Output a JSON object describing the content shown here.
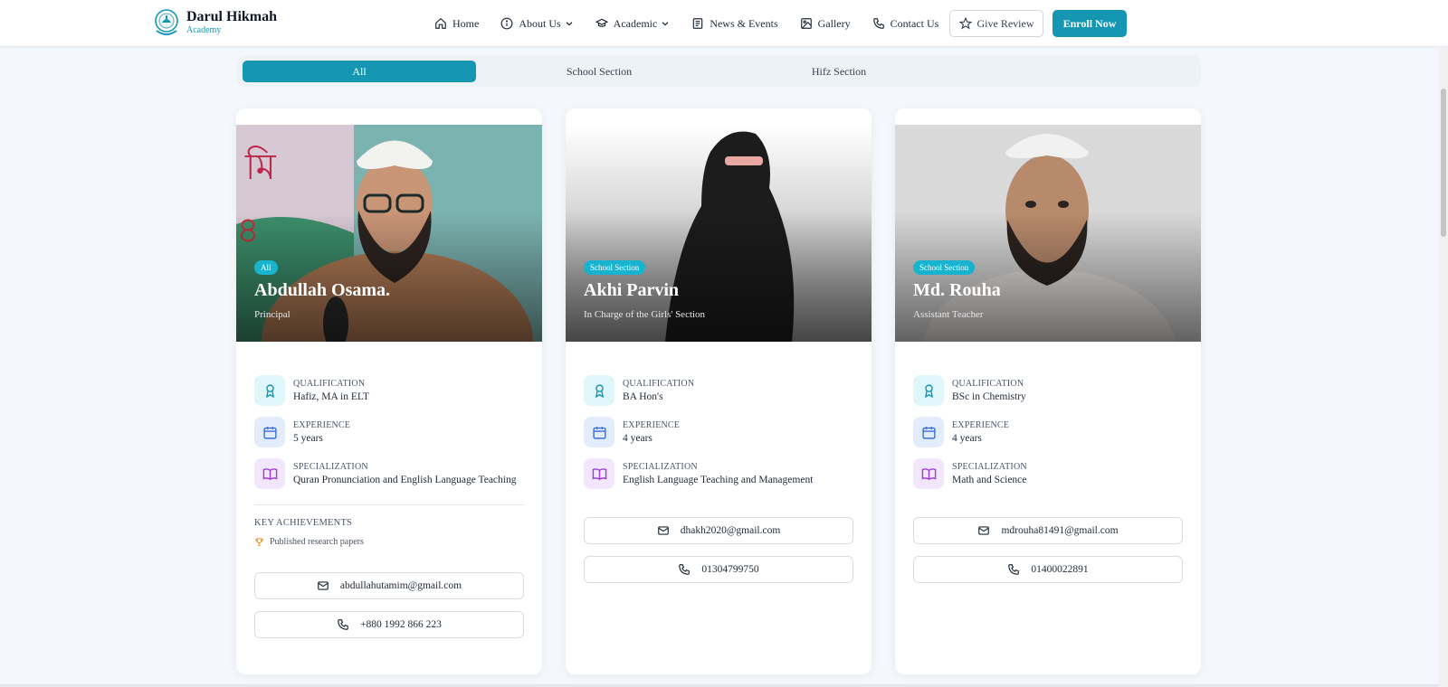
{
  "brand": {
    "name": "Darul Hikmah",
    "subtitle": "Academy"
  },
  "nav": {
    "items": [
      {
        "label": "Home",
        "icon": "home-icon"
      },
      {
        "label": "About Us",
        "icon": "info-icon",
        "dropdown": true
      },
      {
        "label": "Academic",
        "icon": "graduation-cap-icon",
        "dropdown": true
      },
      {
        "label": "News & Events",
        "icon": "newspaper-icon"
      },
      {
        "label": "Gallery",
        "icon": "image-icon"
      },
      {
        "label": "Contact Us",
        "icon": "phone-icon"
      }
    ],
    "review_label": "Give Review",
    "enroll_label": "Enroll Now"
  },
  "tabs": [
    {
      "label": "All",
      "active": true
    },
    {
      "label": "School Section",
      "active": false
    },
    {
      "label": "Hifz Section",
      "active": false
    }
  ],
  "labels": {
    "qualification": "QUALIFICATION",
    "experience": "EXPERIENCE",
    "specialization": "SPECIALIZATION",
    "key_achievements": "KEY ACHIEVEMENTS"
  },
  "teachers": [
    {
      "badge": "All",
      "name": "Abdullah Osama.",
      "role": "Principal",
      "qualification": "Hafiz, MA in ELT",
      "experience": "5 years",
      "specialization": "Quran Pronunciation and English Language Teaching",
      "achievements": [
        "Published research papers"
      ],
      "email": "abdullahutamim@gmail.com",
      "phone": "+880 1992 866 223"
    },
    {
      "badge": "School Section",
      "name": "Akhi Parvin",
      "role": "In Charge of the Girls' Section",
      "qualification": "BA Hon's",
      "experience": "4 years",
      "specialization": "English Language Teaching and Management",
      "email": "dhakh2020@gmail.com",
      "phone": "01304799750"
    },
    {
      "badge": "School Section",
      "name": "Md. Rouha",
      "role": "Assistant Teacher",
      "qualification": "BSc in Chemistry",
      "experience": "4 years",
      "specialization": "Math and Science",
      "email": "mdrouha81491@gmail.com",
      "phone": "01400022891"
    }
  ],
  "colors": {
    "accent": "#1596b3",
    "badge": "#17b3cf",
    "background": "#f4f7fb"
  }
}
